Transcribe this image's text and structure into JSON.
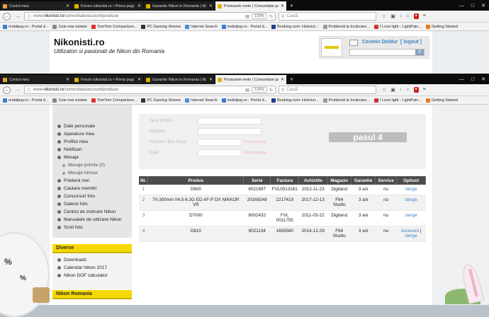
{
  "browser_back": {
    "tabs": [
      {
        "label": "Contul meu",
        "favicon_color": "#e8a33c",
        "active": false
      },
      {
        "label": "Forum nikonisti.ro • Prima pagi",
        "favicon_color": "#e0b000",
        "active": false
      },
      {
        "label": "Garantie Nikon in Romania | Ni",
        "favicon_color": "#e0b000",
        "active": false
      },
      {
        "label": "Produsele mele | Comunitate pa",
        "favicon_color": "#e0b000",
        "active": true
      }
    ],
    "url_prefix": "www.",
    "url_domain": "nikonisti.ro",
    "url_path": "/comunitate/account/produse",
    "zoom": "120%",
    "search_placeholder": "Caută"
  },
  "browser_front": {
    "tabs": [
      {
        "label": "Contul meu",
        "favicon_color": "#e8a33c",
        "active": false
      },
      {
        "label": "Forum nikonisti.ro • Prima pagi",
        "favicon_color": "#e0b000",
        "active": false
      },
      {
        "label": "Garantie Nikon in Romania | Ni",
        "favicon_color": "#e0b000",
        "active": false
      },
      {
        "label": "Produsele mele | Comunitate pa",
        "favicon_color": "#e0b000",
        "active": true
      }
    ],
    "url_prefix": "www.",
    "url_domain": "nikonisti.ro",
    "url_path": "/comunitate/account/produse",
    "zoom": "120%",
    "search_placeholder": "Caută"
  },
  "bookmarks": [
    {
      "label": "mobilpay.ro - Portal d...",
      "color": "#3a7bd5"
    },
    {
      "label": "Cele mai vizitate",
      "color": "#888888"
    },
    {
      "label": "TomTom Comparison...",
      "color": "#d33"
    },
    {
      "label": "PC Gaming Xtreme",
      "color": "#333"
    },
    {
      "label": "Internet Search",
      "color": "#4a90d9"
    },
    {
      "label": "mobilpay.ro - Portal d...",
      "color": "#3a7bd5"
    },
    {
      "label": "Booking.com: Hoteluri...",
      "color": "#1e3c8c"
    },
    {
      "label": "Problemă la încărcare...",
      "color": "#999"
    },
    {
      "label": "I Love light - LightPain...",
      "color": "#c33"
    },
    {
      "label": "Getting Started",
      "color": "#e87a1e"
    }
  ],
  "site": {
    "title": "Nikonisti.ro",
    "subtitle": "Utilizatori si pasionati de Nikon din Romania",
    "user": "Cosmin Doldur",
    "logout": "logout"
  },
  "sidebar": {
    "menu": [
      {
        "label": "Date personale",
        "sub": false
      },
      {
        "label": "Aparatura mea",
        "sub": false
      },
      {
        "label": "Profilul meu",
        "sub": false
      },
      {
        "label": "Notificari",
        "sub": false
      },
      {
        "label": "Mesaje",
        "sub": false
      },
      {
        "label": "Mesaje primite (0)",
        "sub": true
      },
      {
        "label": "Mesaje trimise",
        "sub": true
      },
      {
        "label": "Prietenii mei",
        "sub": false
      },
      {
        "label": "Cautare membri",
        "sub": false
      },
      {
        "label": "Concursuri foto",
        "sub": false
      },
      {
        "label": "Galerie foto",
        "sub": false
      },
      {
        "label": "Centrul de instruire Nikon",
        "sub": false
      },
      {
        "label": "Manualele de utilizare Nikon",
        "sub": false
      },
      {
        "label": "Scoli foto",
        "sub": false
      }
    ],
    "diverse_title": "Diverse",
    "diverse": [
      "Downloads",
      "Calendar Nikon 2017",
      "Nikon DOF calculator"
    ],
    "nikon_title": "Nikon Romania"
  },
  "form": {
    "fields": [
      "Tarie produs",
      "Magazin",
      "Factura / Bon fiscal",
      "Data"
    ],
    "errors": [
      "Fisier invalid",
      "Data invalida"
    ],
    "step_button": "pasul 4"
  },
  "table": {
    "headers": [
      "Nr.",
      "Produs",
      "Serie",
      "Factura",
      "Achizitie",
      "Magazin",
      "Garantie",
      "Service",
      "Optiuni"
    ],
    "rows": [
      {
        "nr": "1",
        "produs": "D600",
        "serie": "6021697",
        "factura": "FVL0013161",
        "achizitie": "2012-11-23",
        "magazin": "Digiland",
        "garantie": "3 ani",
        "service": "nu",
        "optiuni": [
          "sterge"
        ]
      },
      {
        "nr": "2",
        "produs": "70-300mm f/4.5-6.3G ED AF-P DX NIKKOR VR",
        "serie": "20169249",
        "factura": "2217419",
        "achizitie": "2017-12-13",
        "magazin": "F64 Studio",
        "garantie": "3 ani",
        "service": "nu",
        "optiuni": [
          "sterge"
        ]
      },
      {
        "nr": "3",
        "produs": "D7000",
        "serie": "6002432",
        "factura": "FVL 0011755",
        "achizitie": "2011-03-22",
        "magazin": "Digiland",
        "garantie": "3 ani",
        "service": "nu",
        "optiuni": [
          "sterge"
        ]
      },
      {
        "nr": "4",
        "produs": "D810",
        "serie": "6021134",
        "factura": "1693580",
        "achizitie": "2014-12-29",
        "magazin": "F64 Studio",
        "garantie": "3 ani",
        "service": "nu",
        "optiuni": [
          "Accesorii",
          "sterge"
        ]
      }
    ]
  }
}
